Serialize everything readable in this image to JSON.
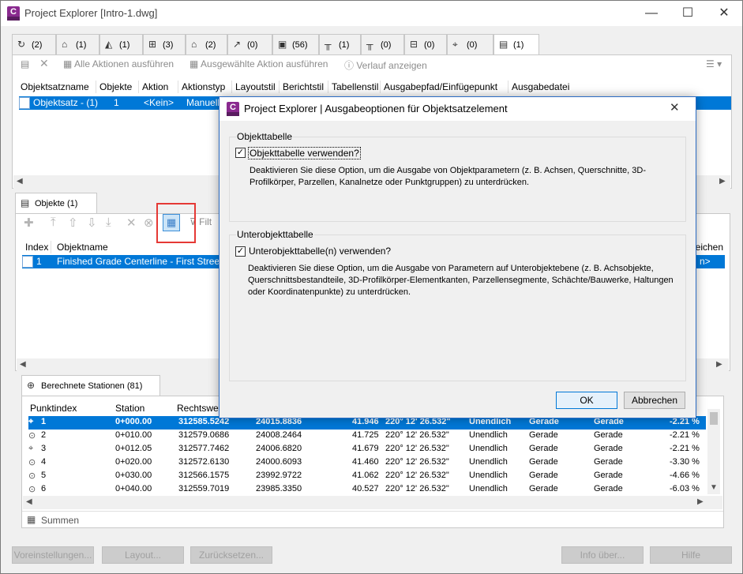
{
  "window": {
    "title": "Project Explorer [Intro-1.dwg]",
    "app_icon_letter": "C",
    "minimize": "—",
    "maximize": "☐",
    "close": "✕"
  },
  "tabs": [
    {
      "icon": "↻",
      "count": "(2)"
    },
    {
      "icon": "⌂",
      "count": "(1)"
    },
    {
      "icon": "◭",
      "count": "(1)"
    },
    {
      "icon": "⊞",
      "count": "(3)"
    },
    {
      "icon": "⌂",
      "count": "(2)"
    },
    {
      "icon": "↗",
      "count": "(0)"
    },
    {
      "icon": "▣",
      "count": "(56)"
    },
    {
      "icon": "╥",
      "count": "(1)"
    },
    {
      "icon": "╥",
      "count": "(0)"
    },
    {
      "icon": "⊟",
      "count": "(0)"
    },
    {
      "icon": "⌖",
      "count": "(0)"
    },
    {
      "icon": "▤",
      "count": "(1)"
    }
  ],
  "top_toolbar": {
    "run_all": "Alle Aktionen ausführen",
    "run_selected": "Ausgewählte Aktion ausführen",
    "show_history": "Verlauf anzeigen"
  },
  "top_grid": {
    "headers": [
      "Objektsatzname",
      "Objekte",
      "Aktion",
      "Aktionstyp",
      "Layoutstil",
      "Berichtstil",
      "Tabellenstil",
      "Ausgabepfad/Einfügepunkt",
      "Ausgabedatei"
    ],
    "row": [
      "Objektsatz - (1)",
      "1",
      "<Kein>",
      "Manuell"
    ]
  },
  "objects_panel": {
    "tab_label": "Objekte (1)",
    "filter_label": "Filt",
    "headers": [
      "Index",
      "Objektname"
    ],
    "right_header": "leichen",
    "row": [
      "1",
      "Finished Grade Centerline - First Street"
    ],
    "row_right": "n>"
  },
  "stations_panel": {
    "tab_label": "Berechnete Stationen (81)",
    "headers": [
      "Punktindex",
      "Station",
      "Rechtswert"
    ],
    "rows": [
      {
        "idx": "1",
        "station": "0+000.00",
        "east": "312585.5242",
        "north": "24015.8836",
        "elev": "41.946",
        "dir": "220° 12' 26.532\"",
        "radius": "Unendlich",
        "t1": "Gerade",
        "t2": "Gerade",
        "grade": "-2.21 %",
        "selected": true
      },
      {
        "idx": "2",
        "station": "0+010.00",
        "east": "312579.0686",
        "north": "24008.2464",
        "elev": "41.725",
        "dir": "220° 12' 26.532\"",
        "radius": "Unendlich",
        "t1": "Gerade",
        "t2": "Gerade",
        "grade": "-2.21 %",
        "selected": false
      },
      {
        "idx": "3",
        "station": "0+012.05",
        "east": "312577.7462",
        "north": "24006.6820",
        "elev": "41.679",
        "dir": "220° 12' 26.532\"",
        "radius": "Unendlich",
        "t1": "Gerade",
        "t2": "Gerade",
        "grade": "-2.21 %",
        "selected": false
      },
      {
        "idx": "4",
        "station": "0+020.00",
        "east": "312572.6130",
        "north": "24000.6093",
        "elev": "41.460",
        "dir": "220° 12' 26.532\"",
        "radius": "Unendlich",
        "t1": "Gerade",
        "t2": "Gerade",
        "grade": "-3.30 %",
        "selected": false
      },
      {
        "idx": "5",
        "station": "0+030.00",
        "east": "312566.1575",
        "north": "23992.9722",
        "elev": "41.062",
        "dir": "220° 12' 26.532\"",
        "radius": "Unendlich",
        "t1": "Gerade",
        "t2": "Gerade",
        "grade": "-4.66 %",
        "selected": false
      },
      {
        "idx": "6",
        "station": "0+040.00",
        "east": "312559.7019",
        "north": "23985.3350",
        "elev": "40.527",
        "dir": "220° 12' 26.532\"",
        "radius": "Unendlich",
        "t1": "Gerade",
        "t2": "Gerade",
        "grade": "-6.03 %",
        "selected": false
      }
    ],
    "summary_label": "Summen"
  },
  "bottom_buttons": {
    "presets": "Voreinstellungen...",
    "layout": "Layout...",
    "reset": "Zurücksetzen...",
    "about": "Info über...",
    "help": "Hilfe"
  },
  "dialog": {
    "title": "Project Explorer | Ausgabeoptionen für Objektsatzelement",
    "close": "✕",
    "group1_label": "Objekttabelle",
    "group1_checkbox": "Objekttabelle verwenden?",
    "group1_desc": "Deaktivieren Sie diese Option, um die Ausgabe von Objektparametern (z. B. Achsen, Querschnitte, 3D-Profilkörper, Parzellen, Kanalnetze oder Punktgruppen) zu unterdrücken.",
    "group2_label": "Unterobjekttabelle",
    "group2_checkbox": "Unterobjekttabelle(n) verwenden?",
    "group2_desc": "Deaktivieren Sie diese Option, um die Ausgabe von Parametern auf Unterobjektebene (z. B. Achsobjekte, Querschnittsbestandteile, 3D-Profilkörper-Elementkanten, Parzellensegmente, Schächte/Bauwerke, Haltungen oder Koordinatenpunkte) zu unterdrücken.",
    "ok": "OK",
    "cancel": "Abbrechen",
    "check_mark": "✓"
  }
}
